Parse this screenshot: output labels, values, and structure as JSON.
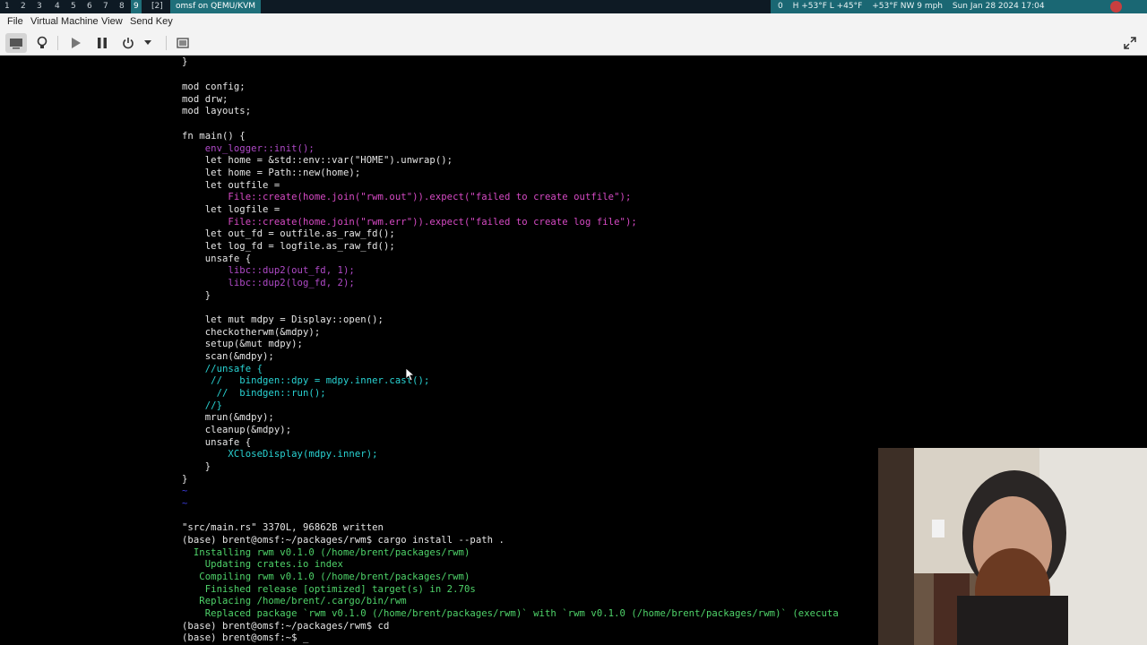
{
  "topbar": {
    "workspaces": [
      {
        "label": "1",
        "sup": ""
      },
      {
        "label": "2",
        "sup": ""
      },
      {
        "label": "3",
        "sup": ""
      },
      {
        "label": "4",
        "sup": ""
      },
      {
        "label": "5",
        "sup": ""
      },
      {
        "label": "6",
        "sup": ""
      },
      {
        "label": "7",
        "sup": ""
      },
      {
        "label": "8",
        "sup": ""
      },
      {
        "label": "9",
        "sup": ""
      },
      {
        "label": "[2]",
        "sup": ""
      }
    ],
    "window_title": "omsf on QEMU/KVM",
    "status_items": [
      "0",
      "H +53°F  L +45°F",
      "+53°F NW 9 mph",
      "Sun Jan 28 2024 17:04"
    ]
  },
  "menubar": {
    "items": [
      "File",
      "Virtual Machine",
      "View",
      "Send Key"
    ]
  },
  "toolbar": {
    "icons": [
      "console-icon",
      "lightbulb-icon",
      "play-icon",
      "pause-icon",
      "power-icon",
      "chevron-down-icon",
      "screenshot-icon",
      "fullscreen-icon"
    ]
  },
  "terminal": {
    "lines": [
      "}",
      "",
      "mod config;",
      "mod drw;",
      "mod layouts;",
      "",
      "fn main() {",
      "    env_logger::init();",
      "    let home = &std::env::var(\"HOME\").unwrap();",
      "    let home = Path::new(home);",
      "    let outfile =",
      "        File::create(home.join(\"rwm.out\")).expect(\"failed to create outfile\");",
      "    let logfile =",
      "        File::create(home.join(\"rwm.err\")).expect(\"failed to create log file\");",
      "    let out_fd = outfile.as_raw_fd();",
      "    let log_fd = logfile.as_raw_fd();",
      "    unsafe {",
      "        libc::dup2(out_fd, 1);",
      "        libc::dup2(log_fd, 2);",
      "    }",
      "",
      "    let mut mdpy = Display::open();",
      "    checkotherwm(&mdpy);",
      "    setup(&mut mdpy);",
      "    scan(&mdpy);",
      "    //unsafe {",
      "     //   bindgen::dpy = mdpy.inner.cast();",
      "      //  bindgen::run();",
      "    //}",
      "    mrun(&mdpy);",
      "    cleanup(&mdpy);",
      "    unsafe {",
      "        XCloseDisplay(mdpy.inner);",
      "    }",
      "}",
      "~",
      "~",
      "",
      "\"src/main.rs\" 3370L, 96862B written",
      "(base) brent@omsf:~/packages/rwm$ cargo install --path .",
      "  Installing rwm v0.1.0 (/home/brent/packages/rwm)",
      "    Updating crates.io index",
      "   Compiling rwm v0.1.0 (/home/brent/packages/rwm)",
      "    Finished release [optimized] target(s) in 2.70s",
      "   Replacing /home/brent/.cargo/bin/rwm",
      "    Replaced package `rwm v0.1.0 (/home/brent/packages/rwm)` with `rwm v0.1.0 (/home/brent/packages/rwm)` (executa",
      "(base) brent@omsf:~/packages/rwm$ cd",
      "(base) brent@omsf:~$ _"
    ]
  },
  "colors": {
    "terminal_bg": "#000000",
    "text": "#e6e6e6",
    "path": "#b04ac8",
    "string": "#d64ac4",
    "cargo_green": "#4fd46a",
    "comment_cyan": "#29d3d3",
    "status_bg": "#1a6773"
  }
}
